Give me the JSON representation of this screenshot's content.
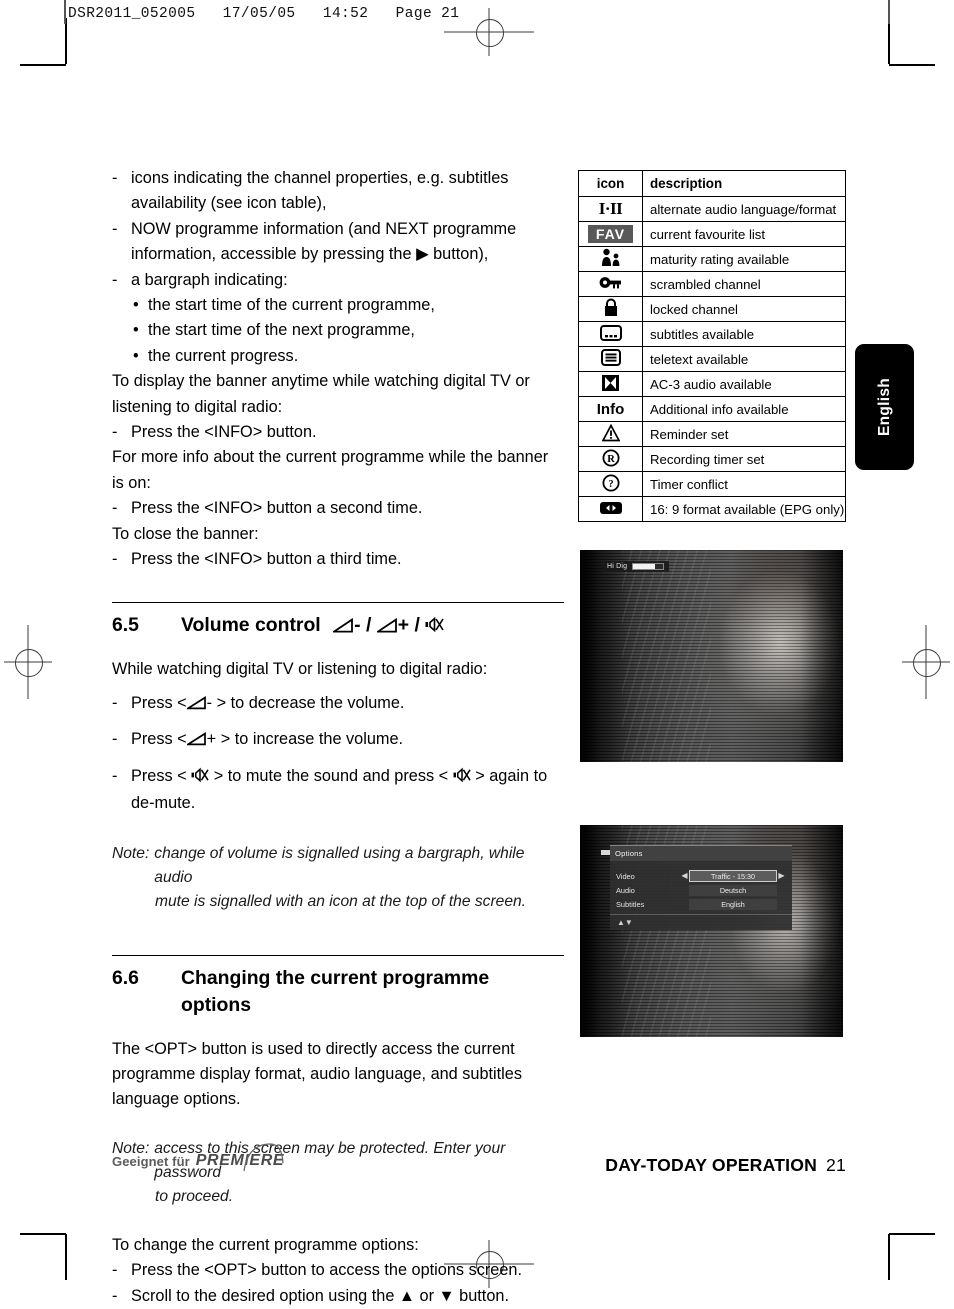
{
  "print_slug": "DSR2011_052005   17/05/05   14:52   Page 21",
  "side_tab": {
    "label": "English"
  },
  "left_column": {
    "bullets_top": [
      {
        "dash": "-",
        "text": "icons indicating the channel properties, e.g. subtitles availability (see icon table),"
      },
      {
        "dash": "-",
        "text": "NOW programme information (and NEXT programme information, accessible by pressing the ▶ button),"
      },
      {
        "dash": "-",
        "text": "a bargraph indicating:"
      }
    ],
    "sub_bullets": [
      {
        "dot": "•",
        "text": "the start time of the current programme,"
      },
      {
        "dot": "•",
        "text": "the start time of the next programme,"
      },
      {
        "dot": "•",
        "text": "the current progress."
      }
    ],
    "para_display_banner": "To display the banner anytime while watching digital TV or listening to digital radio:",
    "step_info_1": {
      "dash": "-",
      "text": "Press the <INFO> button."
    },
    "para_more_info": "For more info about the current programme while the banner is on:",
    "step_info_2": {
      "dash": "-",
      "text": "Press the <INFO> button a second time."
    },
    "para_close_banner": "To close the banner:",
    "step_info_3": {
      "dash": "-",
      "text": "Press the <INFO> button a third time."
    }
  },
  "section_65": {
    "number": "6.5",
    "title": "Volume control",
    "title_glyphs": "◢- / ◢+ / 🔇",
    "intro": "While watching digital TV or listening to digital radio:",
    "steps": [
      {
        "dash": "-",
        "pre": "Press <",
        "glyph": "vol-down",
        "post": "- > to decrease the volume."
      },
      {
        "dash": "-",
        "pre": "Press <",
        "glyph": "vol-up",
        "post": "+ > to increase the volume."
      },
      {
        "dash": "-",
        "pre": "Press <",
        "glyph": "mute",
        "post": "> to mute the sound and press <",
        "glyph2": "mute",
        "post2": "> again to de-mute."
      }
    ],
    "note_label": "Note:",
    "note_text": "change of volume is signalled using a bargraph, while audio",
    "note_text2": "mute is signalled with an icon at the top of the screen."
  },
  "section_66": {
    "number": "6.6",
    "title_line1": "Changing the current programme",
    "title_line2": "options",
    "para": "The <OPT> button is used to directly access the current programme display format, audio language, and subtitles language options.",
    "note_label": "Note:",
    "note_text": "access to this screen may be protected. Enter your password",
    "note_text2": "to proceed.",
    "intro2": "To change the current programme options:",
    "steps2": [
      {
        "dash": "-",
        "text": "Press the <OPT> button to access the options screen."
      },
      {
        "dash": "-",
        "text": "Scroll to the desired option using the ▲ or ▼ button."
      }
    ]
  },
  "icon_table": {
    "headers": {
      "icon": "icon",
      "description": "description"
    },
    "rows": [
      {
        "icon_name": "alternate-audio-icon",
        "glyph": "I·II",
        "description": "alternate audio language/format"
      },
      {
        "icon_name": "favourite-list-icon",
        "glyph": "FAV",
        "description": "current favourite list"
      },
      {
        "icon_name": "maturity-rating-icon",
        "glyph": "people",
        "description": "maturity rating available"
      },
      {
        "icon_name": "scrambled-channel-icon",
        "glyph": "key",
        "description": "scrambled channel"
      },
      {
        "icon_name": "locked-channel-icon",
        "glyph": "padlock",
        "description": "locked channel"
      },
      {
        "icon_name": "subtitles-icon",
        "glyph": "subtitle",
        "description": "subtitles available"
      },
      {
        "icon_name": "teletext-icon",
        "glyph": "teletext",
        "description": "teletext available"
      },
      {
        "icon_name": "ac3-audio-icon",
        "glyph": "ac3",
        "description": "AC-3 audio available"
      },
      {
        "icon_name": "additional-info-icon",
        "glyph": "Info",
        "description": "Additional info available"
      },
      {
        "icon_name": "reminder-icon",
        "glyph": "warning",
        "description": "Reminder set"
      },
      {
        "icon_name": "recording-timer-icon",
        "glyph": "R",
        "description": "Recording timer set"
      },
      {
        "icon_name": "timer-conflict-icon",
        "glyph": "?",
        "description": "Timer conflict"
      },
      {
        "icon_name": "widescreen-icon",
        "glyph": "16:9",
        "description": "16: 9 format available (EPG only)"
      }
    ]
  },
  "screenshot_volume": {
    "caption_text": "Hi Dig",
    "volume_percent": 72
  },
  "screenshot_options": {
    "menu_title": "Options",
    "rows": [
      {
        "label": "Video",
        "value": "Traffic - 15:30",
        "selected": true
      },
      {
        "label": "Audio",
        "value": "Deutsch",
        "selected": false
      },
      {
        "label": "Subtitles",
        "value": "English",
        "selected": false
      }
    ],
    "footer_arrows": "▲▼"
  },
  "footer": {
    "logo_pre": "Geeignet für",
    "logo_brand": "PREMIERE",
    "section": "DAY-TODAY OPERATION",
    "page_number": "21"
  }
}
